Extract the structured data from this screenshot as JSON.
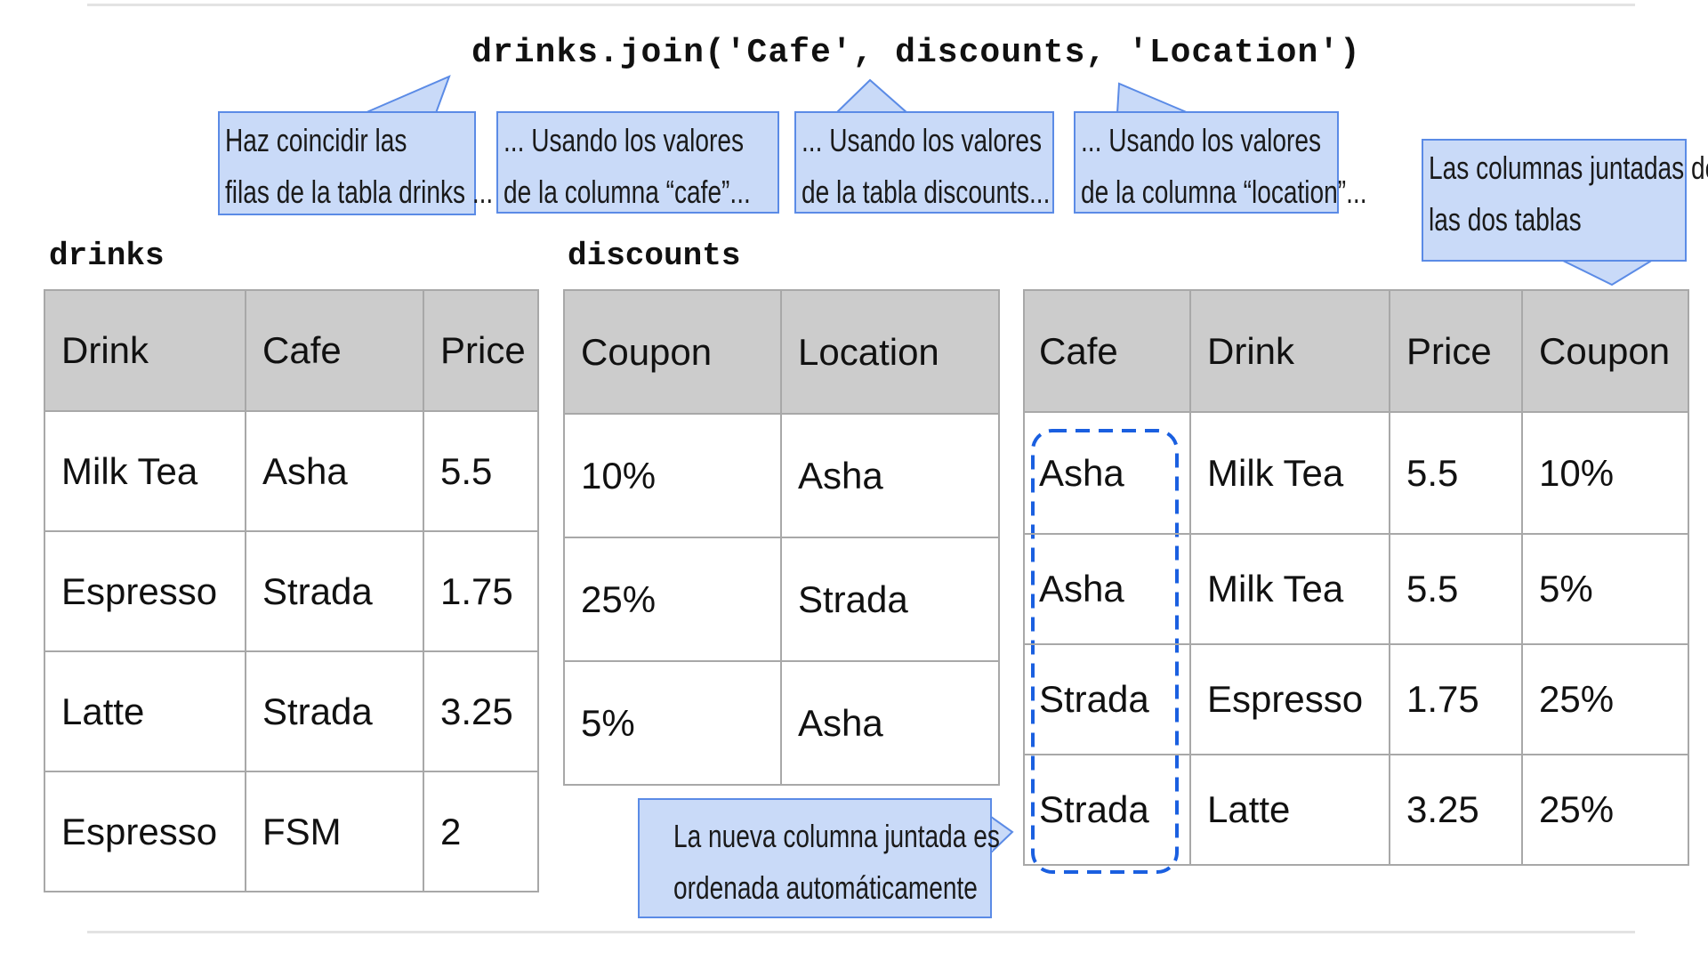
{
  "code_line": "drinks.join('Cafe', discounts, 'Location')",
  "callouts": {
    "match_rows": [
      "Haz coincidir las",
      "filas de la tabla drinks ..."
    ],
    "cafe_column": [
      "... Usando los valores",
      "de la columna “cafe”..."
    ],
    "discounts_table": [
      "... Usando los valores",
      "de la tabla discounts..."
    ],
    "location_column": [
      "... Usando los valores",
      "de la columna “location”..."
    ],
    "joined_columns": [
      "Las columnas juntadas de",
      "las dos tablas"
    ],
    "sorted_column": [
      "La nueva columna juntada es",
      "ordenada automáticamente"
    ]
  },
  "drinks": {
    "label": "drinks",
    "headers": [
      "Drink",
      "Cafe",
      "Price"
    ],
    "rows": [
      [
        "Milk Tea",
        "Asha",
        "5.5"
      ],
      [
        "Espresso",
        "Strada",
        "1.75"
      ],
      [
        "Latte",
        "Strada",
        "3.25"
      ],
      [
        "Espresso",
        "FSM",
        "2"
      ]
    ]
  },
  "discounts": {
    "label": "discounts",
    "headers": [
      "Coupon",
      "Location"
    ],
    "rows": [
      [
        "10%",
        "Asha"
      ],
      [
        "25%",
        "Strada"
      ],
      [
        "5%",
        "Asha"
      ]
    ]
  },
  "result": {
    "headers": [
      "Cafe",
      "Drink",
      "Price",
      "Coupon"
    ],
    "rows": [
      [
        "Asha",
        "Milk Tea",
        "5.5",
        "10%"
      ],
      [
        "Asha",
        "Milk Tea",
        "5.5",
        "5%"
      ],
      [
        "Strada",
        "Espresso",
        "1.75",
        "25%"
      ],
      [
        "Strada",
        "Latte",
        "3.25",
        "25%"
      ]
    ]
  },
  "colors": {
    "callout_fill": "#c9daf8",
    "callout_border": "#5b8be6",
    "dashed_highlight": "#1a5fe0",
    "header_fill": "#cccccc"
  }
}
